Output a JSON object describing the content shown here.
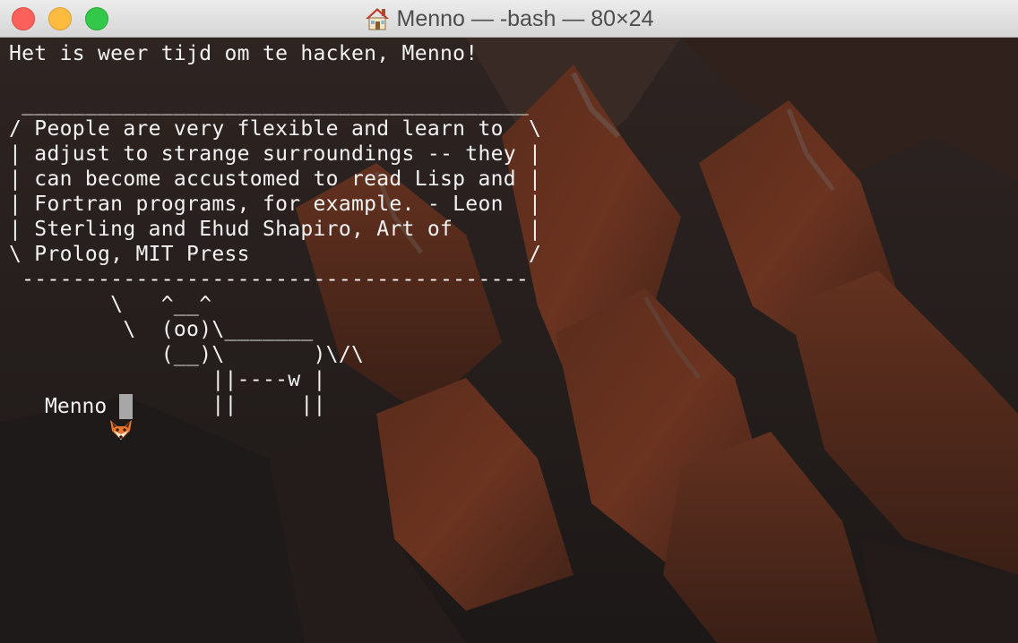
{
  "window": {
    "title": "Menno — -bash — 80×24",
    "title_icon": "home-icon"
  },
  "terminal": {
    "lines": [
      "Het is weer tijd om te hacken, Menno!",
      "",
      " ________________________________________",
      "/ People are very flexible and learn to  \\",
      "| adjust to strange surroundings -- they |",
      "| can become accustomed to read Lisp and |",
      "| Fortran programs, for example. - Leon  |",
      "| Sterling and Ehud Shapiro, Art of      |",
      "\\ Prolog, MIT Press                      /",
      " ----------------------------------------",
      "        \\   ^__^",
      "         \\  (oo)\\_______",
      "            (__)\\       )\\/\\",
      "                ||----w |",
      "                ||     ||"
    ],
    "prompt": {
      "icon": "fox-icon",
      "user": "Menno"
    }
  },
  "colors": {
    "text": "#f2f2f2",
    "cursor": "#a7a7a7",
    "close": "#fc605b",
    "minimize": "#fdbc40",
    "maximize": "#34c84a"
  }
}
